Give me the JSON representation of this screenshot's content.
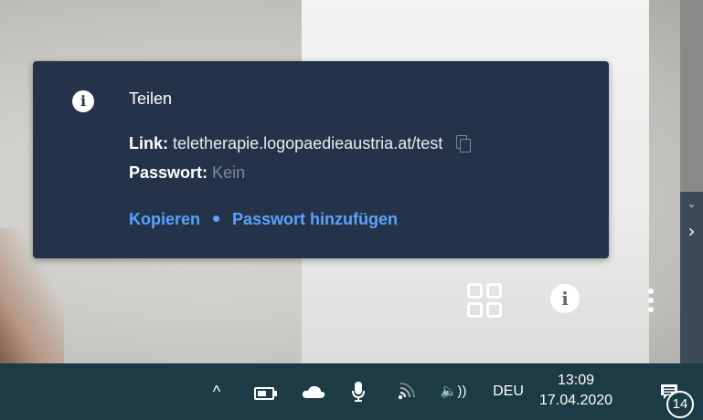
{
  "share_popup": {
    "title": "Teilen",
    "link_label": "Link:",
    "link_value": "teletherapie.logopaedieaustria.at/test",
    "password_label": "Passwort:",
    "password_value": "Kein",
    "copy_action": "Kopieren",
    "add_password_action": "Passwort hinzufügen",
    "icons": [
      "info-icon",
      "copy-icon"
    ]
  },
  "video_controls": {
    "icons": [
      "grid-view-icon",
      "info-icon",
      "more-vert-icon"
    ]
  },
  "taskbar": {
    "chevron": "^",
    "language": "DEU",
    "time": "13:09",
    "date": "17.04.2020",
    "notification_count": "14",
    "icons": [
      "chevron-up-icon",
      "battery-icon",
      "onedrive-cloud-icon",
      "microphone-icon",
      "wifi-icon",
      "speaker-icon",
      "action-center-icon"
    ]
  },
  "colors": {
    "popup_bg": "#25334a",
    "accent": "#5aa2ff",
    "taskbar_bg": "#1c3b45"
  }
}
